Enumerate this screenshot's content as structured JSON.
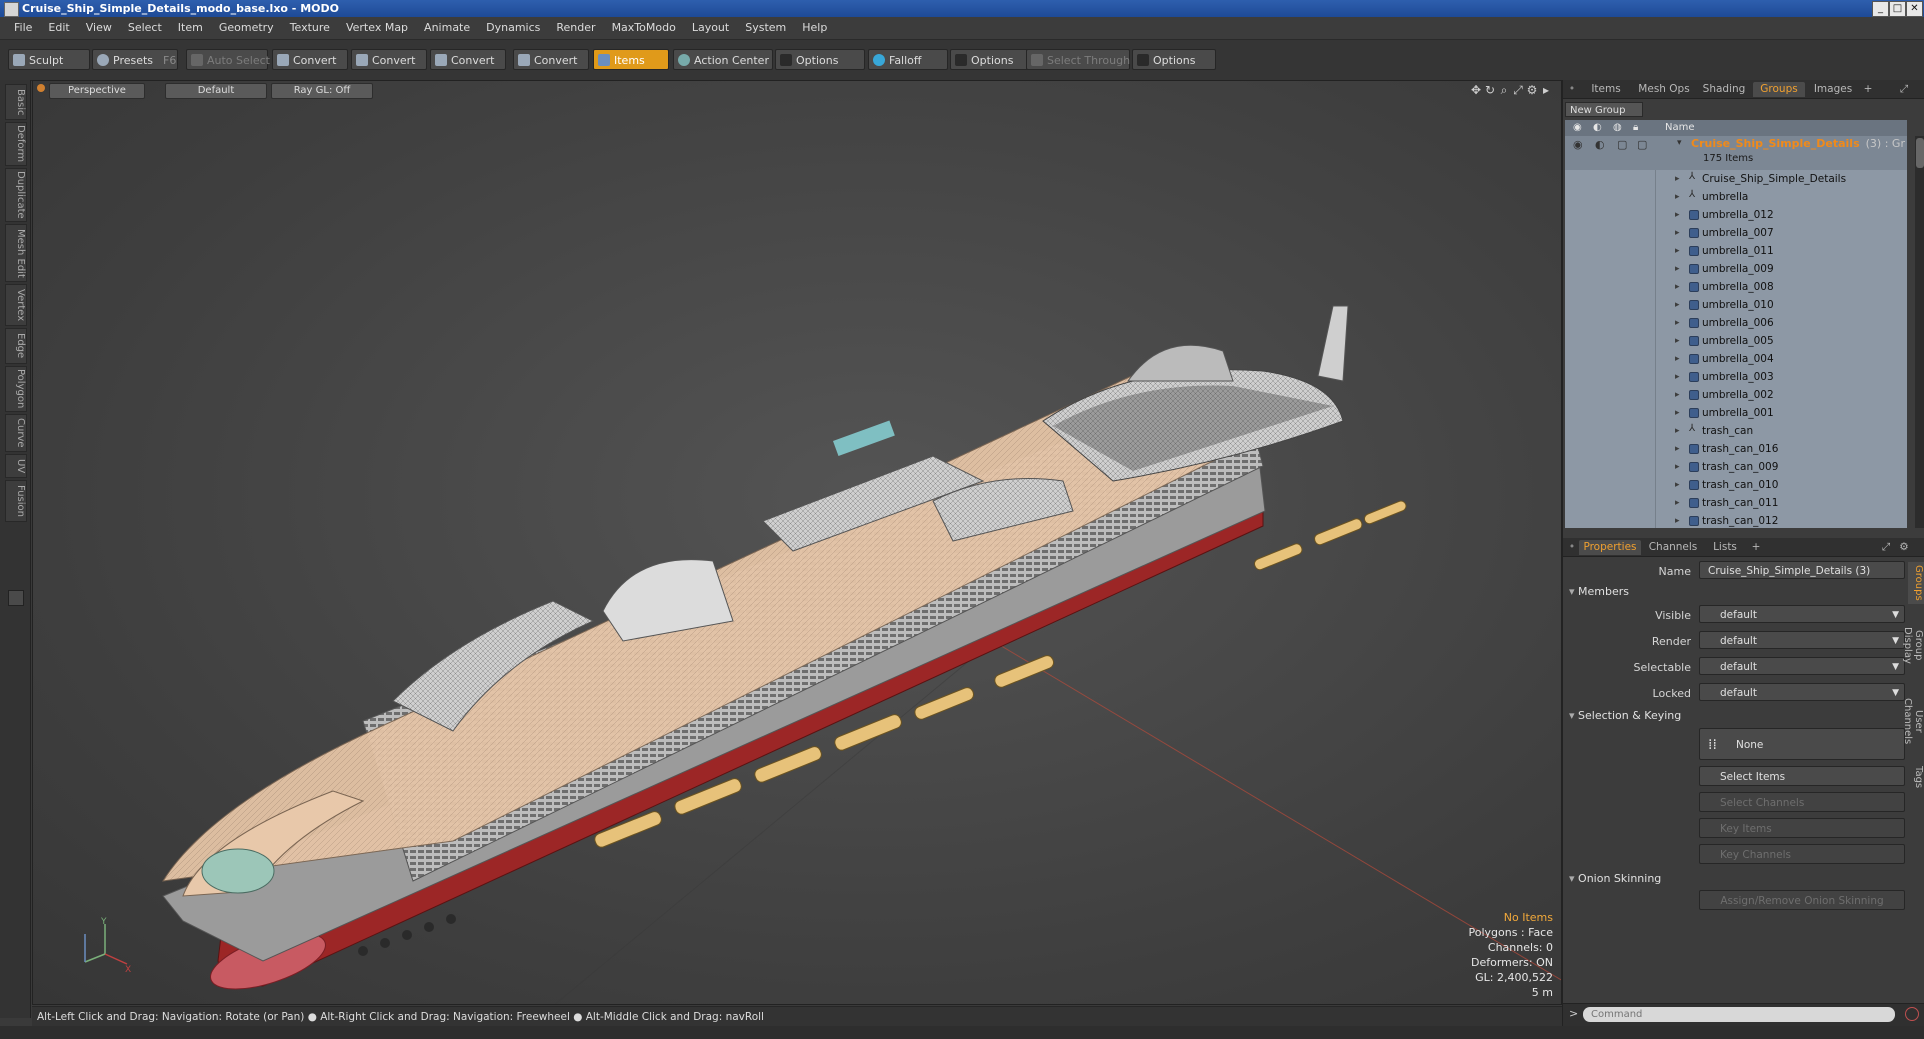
{
  "window": {
    "title": "Cruise_Ship_Simple_Details_modo_base.lxo - MODO",
    "controls": [
      "_",
      "□",
      "✕"
    ]
  },
  "menu": [
    "File",
    "Edit",
    "View",
    "Select",
    "Item",
    "Geometry",
    "Texture",
    "Vertex Map",
    "Animate",
    "Dynamics",
    "Render",
    "MaxToModo",
    "Layout",
    "System",
    "Help"
  ],
  "toolbar": {
    "sculpt": "Sculpt",
    "presets": "Presets",
    "presets_key": "F6",
    "auto_select": "Auto Select",
    "convert1": "Convert",
    "convert2": "Convert",
    "convert3": "Convert",
    "convert4": "Convert",
    "items": "Items",
    "action_center": "Action Center",
    "options1": "Options",
    "falloff": "Falloff",
    "options2": "Options",
    "select_through": "Select Through",
    "options3": "Options"
  },
  "left_tabs": [
    "Basic",
    "Deform",
    "Duplicate",
    "Mesh Edit",
    "Vertex",
    "Edge",
    "Polygon",
    "Curve",
    "UV",
    "Fusion"
  ],
  "viewport": {
    "view": "Perspective",
    "shading": "Default",
    "raygl": "Ray GL: Off",
    "stats": {
      "items": "No Items",
      "polygons": "Polygons : Face",
      "channels": "Channels: 0",
      "deformers": "Deformers: ON",
      "gl": "GL: 2,400,522",
      "scale": "5 m"
    },
    "axis_y": "Y",
    "axis_x": "X"
  },
  "statusbar": "Alt-Left Click and Drag: Navigation: Rotate (or Pan) ● Alt-Right Click and Drag: Navigation: Freewheel ● Alt-Middle Click and Drag: navRoll",
  "top_tabs": [
    "Items",
    "Mesh Ops",
    "Shading",
    "Groups",
    "Images",
    "+"
  ],
  "groups": {
    "new_group": "New Group",
    "name_col": "Name",
    "group_name": "Cruise_Ship_Simple_Details",
    "group_suffix": "(3) : Gr",
    "count": "175 Items",
    "items": [
      "Cruise_Ship_Simple_Details",
      "umbrella",
      "umbrella_012",
      "umbrella_007",
      "umbrella_011",
      "umbrella_009",
      "umbrella_008",
      "umbrella_010",
      "umbrella_006",
      "umbrella_005",
      "umbrella_004",
      "umbrella_003",
      "umbrella_002",
      "umbrella_001",
      "trash_can",
      "trash_can_016",
      "trash_can_009",
      "trash_can_010",
      "trash_can_011",
      "trash_can_012"
    ]
  },
  "prop_tabs": [
    "Properties",
    "Channels",
    "Lists",
    "+"
  ],
  "properties": {
    "name_label": "Name",
    "name_value": "Cruise_Ship_Simple_Details (3)",
    "members": "Members",
    "visible_label": "Visible",
    "visible_value": "default",
    "render_label": "Render",
    "render_value": "default",
    "selectable_label": "Selectable",
    "selectable_value": "default",
    "locked_label": "Locked",
    "locked_value": "default",
    "selection_keying": "Selection & Keying",
    "none": "None",
    "select_items": "Select Items",
    "select_channels": "Select Channels",
    "key_items": "Key Items",
    "key_channels": "Key Channels",
    "onion": "Onion Skinning",
    "assign_onion": "Assign/Remove Onion Skinning"
  },
  "side_tabs": [
    "Groups",
    "Group Display",
    "User Channels",
    "Tags"
  ],
  "command_placeholder": "Command"
}
